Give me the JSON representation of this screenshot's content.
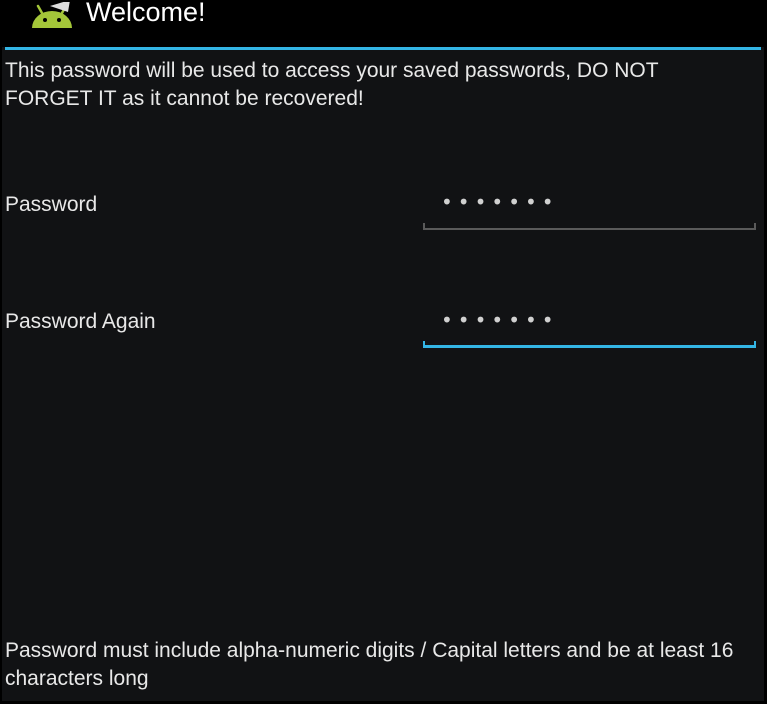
{
  "app_bar": {
    "title": "Welcome!",
    "icon": "android-icon"
  },
  "colors": {
    "accent": "#33b5e5",
    "background": "#111214"
  },
  "main": {
    "warning": "This password will be used to access your saved passwords, DO NOT FORGET IT as it cannot be recovered!",
    "fields": [
      {
        "label": "Password",
        "value_masked": "•••••••"
      },
      {
        "label": "Password Again",
        "value_masked": "•••••••"
      }
    ],
    "hint": "Password must include alpha-numeric digits / Capital letters and be at least 16 characters long"
  }
}
